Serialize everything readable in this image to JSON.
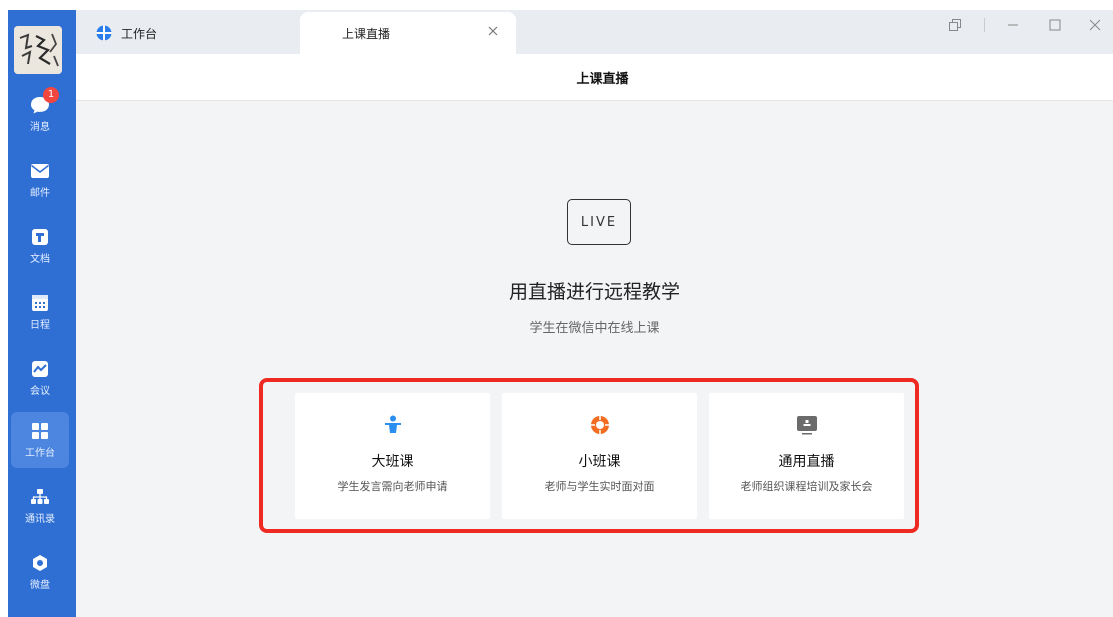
{
  "sidebar": {
    "items": [
      {
        "label": "消息",
        "icon": "chat-bubble-icon",
        "badge": "1"
      },
      {
        "label": "邮件",
        "icon": "mail-icon"
      },
      {
        "label": "文档",
        "icon": "document-icon"
      },
      {
        "label": "日程",
        "icon": "calendar-icon"
      },
      {
        "label": "会议",
        "icon": "meeting-icon"
      },
      {
        "label": "工作台",
        "icon": "workbench-grid-icon"
      },
      {
        "label": "通讯录",
        "icon": "contacts-org-icon"
      },
      {
        "label": "微盘",
        "icon": "drive-icon"
      }
    ]
  },
  "tabs": [
    {
      "label": "工作台"
    },
    {
      "label": "上课直播"
    }
  ],
  "header": {
    "title": "上课直播"
  },
  "main": {
    "live_badge": "LIVE",
    "headline": "用直播进行远程教学",
    "subheadline": "学生在微信中在线上课",
    "cards": [
      {
        "title": "大班课",
        "desc": "学生发言需向老师申请",
        "icon": "teacher-podium-icon"
      },
      {
        "title": "小班课",
        "desc": "老师与学生实时面对面",
        "icon": "orange-circle-icon"
      },
      {
        "title": "通用直播",
        "desc": "老师组织课程培训及家长会",
        "icon": "monitor-icon"
      }
    ]
  },
  "colors": {
    "sidebar": "#2f6fd4",
    "highlight": "#ee2a22",
    "blue_icon": "#2b8ef0",
    "orange_icon": "#f36c21"
  }
}
